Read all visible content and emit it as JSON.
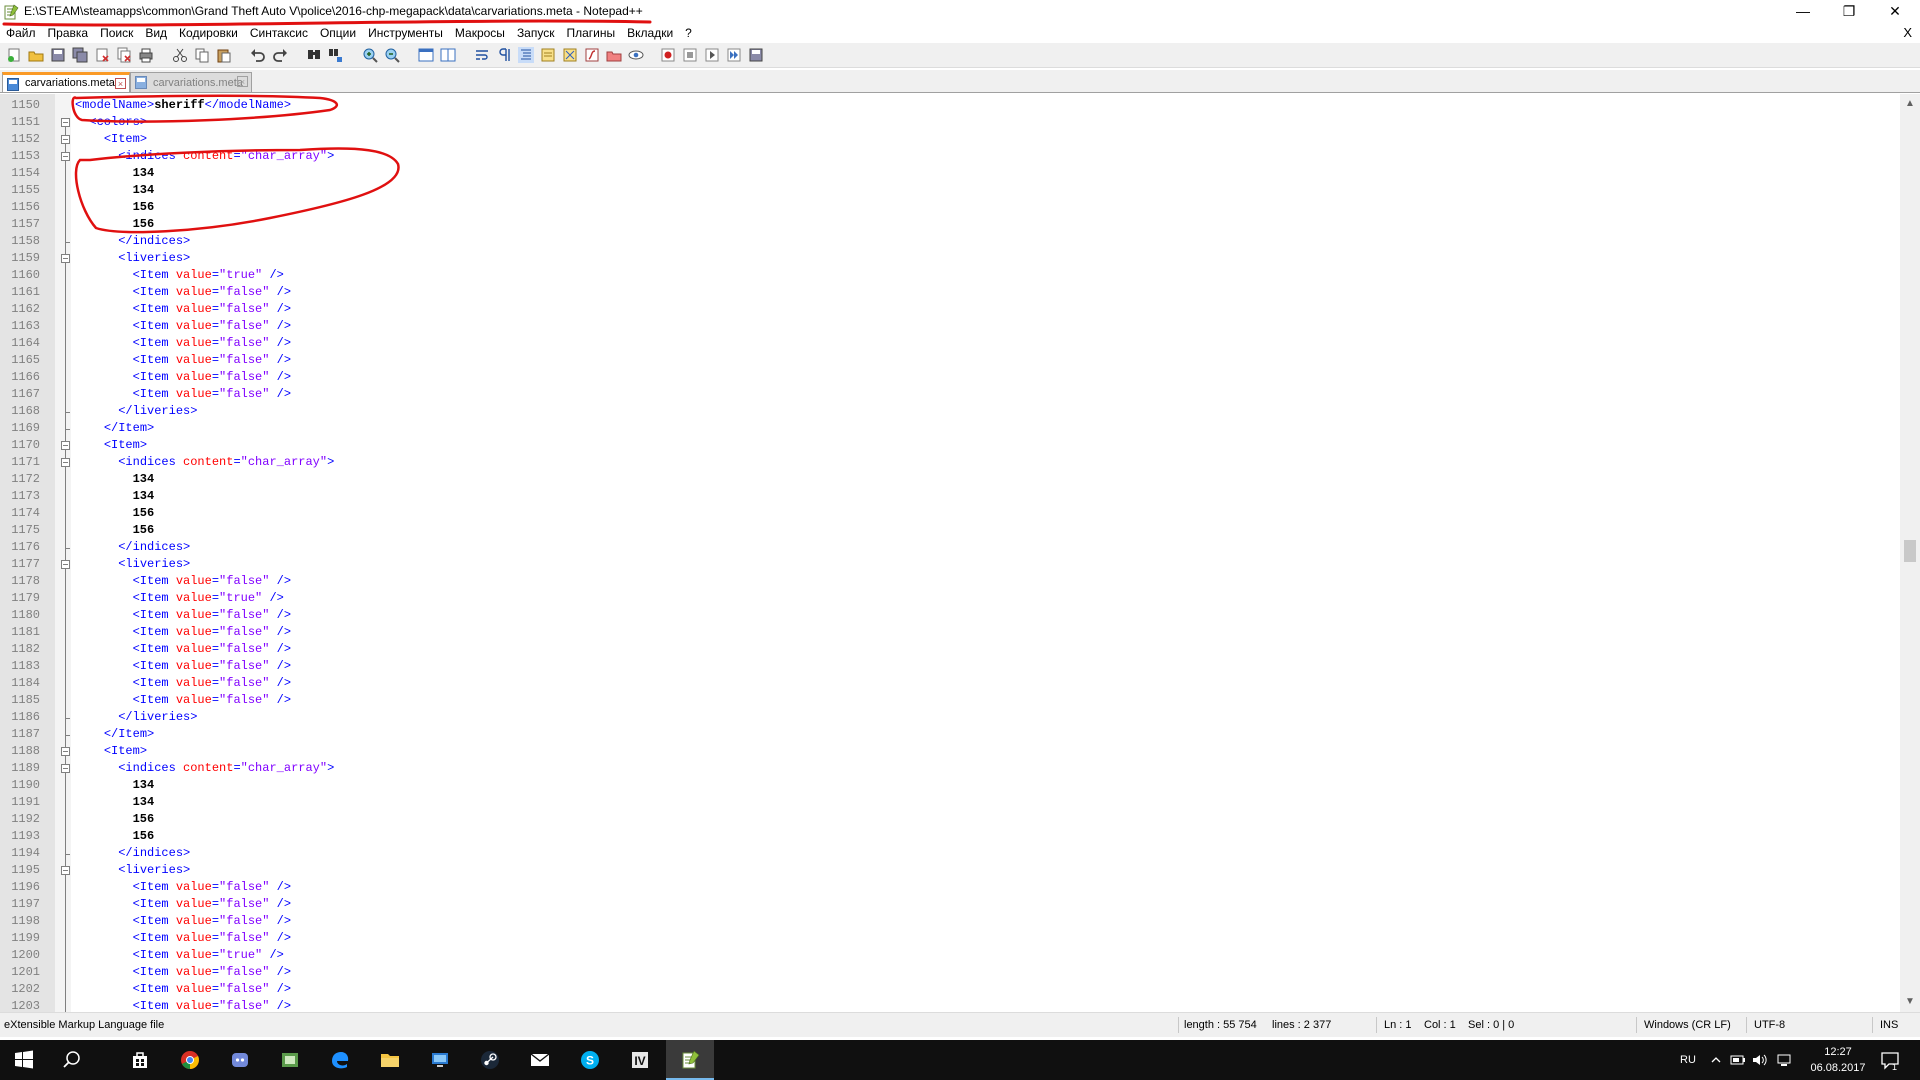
{
  "window": {
    "title": "E:\\STEAM\\steamapps\\common\\Grand Theft Auto V\\police\\2016-chp-megapack\\data\\carvariations.meta - Notepad++",
    "minimize": "—",
    "maximize": "❐",
    "close": "✕",
    "doc_close": "X"
  },
  "menu": [
    "Файл",
    "Правка",
    "Поиск",
    "Вид",
    "Кодировки",
    "Синтаксис",
    "Опции",
    "Инструменты",
    "Макросы",
    "Запуск",
    "Плагины",
    "Вкладки",
    "?"
  ],
  "tabs": [
    {
      "label": "carvariations.meta",
      "active": true
    },
    {
      "label": "carvariations.meta",
      "active": false
    }
  ],
  "code": [
    {
      "ln": "1150",
      "fold": "none",
      "tokens": [
        [
          "t",
          "<modelName>"
        ],
        [
          "x",
          "sheriff"
        ],
        [
          "t",
          "</modelName>"
        ]
      ]
    },
    {
      "ln": "1151",
      "fold": "open",
      "tokens": [
        [
          "s",
          "  "
        ],
        [
          "t",
          "<colors>"
        ]
      ]
    },
    {
      "ln": "1152",
      "fold": "open",
      "tokens": [
        [
          "s",
          "    "
        ],
        [
          "t",
          "<Item>"
        ]
      ]
    },
    {
      "ln": "1153",
      "fold": "open",
      "tokens": [
        [
          "s",
          "      "
        ],
        [
          "t",
          "<indices "
        ],
        [
          "a",
          "content"
        ],
        [
          "t",
          "="
        ],
        [
          "v",
          "\"char_array\""
        ],
        [
          "t",
          ">"
        ]
      ]
    },
    {
      "ln": "1154",
      "fold": "line",
      "tokens": [
        [
          "s",
          "        "
        ],
        [
          "x",
          "134"
        ]
      ]
    },
    {
      "ln": "1155",
      "fold": "line",
      "tokens": [
        [
          "s",
          "        "
        ],
        [
          "x",
          "134"
        ]
      ]
    },
    {
      "ln": "1156",
      "fold": "line",
      "tokens": [
        [
          "s",
          "        "
        ],
        [
          "x",
          "156"
        ]
      ]
    },
    {
      "ln": "1157",
      "fold": "line",
      "tokens": [
        [
          "s",
          "        "
        ],
        [
          "x",
          "156"
        ]
      ]
    },
    {
      "ln": "1158",
      "fold": "end",
      "tokens": [
        [
          "s",
          "      "
        ],
        [
          "t",
          "</indices>"
        ]
      ]
    },
    {
      "ln": "1159",
      "fold": "open",
      "tokens": [
        [
          "s",
          "      "
        ],
        [
          "t",
          "<liveries>"
        ]
      ]
    },
    {
      "ln": "1160",
      "fold": "line",
      "tokens": [
        [
          "s",
          "        "
        ],
        [
          "t",
          "<Item "
        ],
        [
          "a",
          "value"
        ],
        [
          "t",
          "="
        ],
        [
          "v",
          "\"true\""
        ],
        [
          "t",
          " />"
        ]
      ]
    },
    {
      "ln": "1161",
      "fold": "line",
      "tokens": [
        [
          "s",
          "        "
        ],
        [
          "t",
          "<Item "
        ],
        [
          "a",
          "value"
        ],
        [
          "t",
          "="
        ],
        [
          "v",
          "\"false\""
        ],
        [
          "t",
          " />"
        ]
      ]
    },
    {
      "ln": "1162",
      "fold": "line",
      "tokens": [
        [
          "s",
          "        "
        ],
        [
          "t",
          "<Item "
        ],
        [
          "a",
          "value"
        ],
        [
          "t",
          "="
        ],
        [
          "v",
          "\"false\""
        ],
        [
          "t",
          " />"
        ]
      ]
    },
    {
      "ln": "1163",
      "fold": "line",
      "tokens": [
        [
          "s",
          "        "
        ],
        [
          "t",
          "<Item "
        ],
        [
          "a",
          "value"
        ],
        [
          "t",
          "="
        ],
        [
          "v",
          "\"false\""
        ],
        [
          "t",
          " />"
        ]
      ]
    },
    {
      "ln": "1164",
      "fold": "line",
      "tokens": [
        [
          "s",
          "        "
        ],
        [
          "t",
          "<Item "
        ],
        [
          "a",
          "value"
        ],
        [
          "t",
          "="
        ],
        [
          "v",
          "\"false\""
        ],
        [
          "t",
          " />"
        ]
      ]
    },
    {
      "ln": "1165",
      "fold": "line",
      "tokens": [
        [
          "s",
          "        "
        ],
        [
          "t",
          "<Item "
        ],
        [
          "a",
          "value"
        ],
        [
          "t",
          "="
        ],
        [
          "v",
          "\"false\""
        ],
        [
          "t",
          " />"
        ]
      ]
    },
    {
      "ln": "1166",
      "fold": "line",
      "tokens": [
        [
          "s",
          "        "
        ],
        [
          "t",
          "<Item "
        ],
        [
          "a",
          "value"
        ],
        [
          "t",
          "="
        ],
        [
          "v",
          "\"false\""
        ],
        [
          "t",
          " />"
        ]
      ]
    },
    {
      "ln": "1167",
      "fold": "line",
      "tokens": [
        [
          "s",
          "        "
        ],
        [
          "t",
          "<Item "
        ],
        [
          "a",
          "value"
        ],
        [
          "t",
          "="
        ],
        [
          "v",
          "\"false\""
        ],
        [
          "t",
          " />"
        ]
      ]
    },
    {
      "ln": "1168",
      "fold": "end",
      "tokens": [
        [
          "s",
          "      "
        ],
        [
          "t",
          "</liveries>"
        ]
      ]
    },
    {
      "ln": "1169",
      "fold": "end",
      "tokens": [
        [
          "s",
          "    "
        ],
        [
          "t",
          "</Item>"
        ]
      ]
    },
    {
      "ln": "1170",
      "fold": "open",
      "tokens": [
        [
          "s",
          "    "
        ],
        [
          "t",
          "<Item>"
        ]
      ]
    },
    {
      "ln": "1171",
      "fold": "open",
      "tokens": [
        [
          "s",
          "      "
        ],
        [
          "t",
          "<indices "
        ],
        [
          "a",
          "content"
        ],
        [
          "t",
          "="
        ],
        [
          "v",
          "\"char_array\""
        ],
        [
          "t",
          ">"
        ]
      ]
    },
    {
      "ln": "1172",
      "fold": "line",
      "tokens": [
        [
          "s",
          "        "
        ],
        [
          "x",
          "134"
        ]
      ]
    },
    {
      "ln": "1173",
      "fold": "line",
      "tokens": [
        [
          "s",
          "        "
        ],
        [
          "x",
          "134"
        ]
      ]
    },
    {
      "ln": "1174",
      "fold": "line",
      "tokens": [
        [
          "s",
          "        "
        ],
        [
          "x",
          "156"
        ]
      ]
    },
    {
      "ln": "1175",
      "fold": "line",
      "tokens": [
        [
          "s",
          "        "
        ],
        [
          "x",
          "156"
        ]
      ]
    },
    {
      "ln": "1176",
      "fold": "end",
      "tokens": [
        [
          "s",
          "      "
        ],
        [
          "t",
          "</indices>"
        ]
      ]
    },
    {
      "ln": "1177",
      "fold": "open",
      "tokens": [
        [
          "s",
          "      "
        ],
        [
          "t",
          "<liveries>"
        ]
      ]
    },
    {
      "ln": "1178",
      "fold": "line",
      "tokens": [
        [
          "s",
          "        "
        ],
        [
          "t",
          "<Item "
        ],
        [
          "a",
          "value"
        ],
        [
          "t",
          "="
        ],
        [
          "v",
          "\"false\""
        ],
        [
          "t",
          " />"
        ]
      ]
    },
    {
      "ln": "1179",
      "fold": "line",
      "tokens": [
        [
          "s",
          "        "
        ],
        [
          "t",
          "<Item "
        ],
        [
          "a",
          "value"
        ],
        [
          "t",
          "="
        ],
        [
          "v",
          "\"true\""
        ],
        [
          "t",
          " />"
        ]
      ]
    },
    {
      "ln": "1180",
      "fold": "line",
      "tokens": [
        [
          "s",
          "        "
        ],
        [
          "t",
          "<Item "
        ],
        [
          "a",
          "value"
        ],
        [
          "t",
          "="
        ],
        [
          "v",
          "\"false\""
        ],
        [
          "t",
          " />"
        ]
      ]
    },
    {
      "ln": "1181",
      "fold": "line",
      "tokens": [
        [
          "s",
          "        "
        ],
        [
          "t",
          "<Item "
        ],
        [
          "a",
          "value"
        ],
        [
          "t",
          "="
        ],
        [
          "v",
          "\"false\""
        ],
        [
          "t",
          " />"
        ]
      ]
    },
    {
      "ln": "1182",
      "fold": "line",
      "tokens": [
        [
          "s",
          "        "
        ],
        [
          "t",
          "<Item "
        ],
        [
          "a",
          "value"
        ],
        [
          "t",
          "="
        ],
        [
          "v",
          "\"false\""
        ],
        [
          "t",
          " />"
        ]
      ]
    },
    {
      "ln": "1183",
      "fold": "line",
      "tokens": [
        [
          "s",
          "        "
        ],
        [
          "t",
          "<Item "
        ],
        [
          "a",
          "value"
        ],
        [
          "t",
          "="
        ],
        [
          "v",
          "\"false\""
        ],
        [
          "t",
          " />"
        ]
      ]
    },
    {
      "ln": "1184",
      "fold": "line",
      "tokens": [
        [
          "s",
          "        "
        ],
        [
          "t",
          "<Item "
        ],
        [
          "a",
          "value"
        ],
        [
          "t",
          "="
        ],
        [
          "v",
          "\"false\""
        ],
        [
          "t",
          " />"
        ]
      ]
    },
    {
      "ln": "1185",
      "fold": "line",
      "tokens": [
        [
          "s",
          "        "
        ],
        [
          "t",
          "<Item "
        ],
        [
          "a",
          "value"
        ],
        [
          "t",
          "="
        ],
        [
          "v",
          "\"false\""
        ],
        [
          "t",
          " />"
        ]
      ]
    },
    {
      "ln": "1186",
      "fold": "end",
      "tokens": [
        [
          "s",
          "      "
        ],
        [
          "t",
          "</liveries>"
        ]
      ]
    },
    {
      "ln": "1187",
      "fold": "end",
      "tokens": [
        [
          "s",
          "    "
        ],
        [
          "t",
          "</Item>"
        ]
      ]
    },
    {
      "ln": "1188",
      "fold": "open",
      "tokens": [
        [
          "s",
          "    "
        ],
        [
          "t",
          "<Item>"
        ]
      ]
    },
    {
      "ln": "1189",
      "fold": "open",
      "tokens": [
        [
          "s",
          "      "
        ],
        [
          "t",
          "<indices "
        ],
        [
          "a",
          "content"
        ],
        [
          "t",
          "="
        ],
        [
          "v",
          "\"char_array\""
        ],
        [
          "t",
          ">"
        ]
      ]
    },
    {
      "ln": "1190",
      "fold": "line",
      "tokens": [
        [
          "s",
          "        "
        ],
        [
          "x",
          "134"
        ]
      ]
    },
    {
      "ln": "1191",
      "fold": "line",
      "tokens": [
        [
          "s",
          "        "
        ],
        [
          "x",
          "134"
        ]
      ]
    },
    {
      "ln": "1192",
      "fold": "line",
      "tokens": [
        [
          "s",
          "        "
        ],
        [
          "x",
          "156"
        ]
      ]
    },
    {
      "ln": "1193",
      "fold": "line",
      "tokens": [
        [
          "s",
          "        "
        ],
        [
          "x",
          "156"
        ]
      ]
    },
    {
      "ln": "1194",
      "fold": "end",
      "tokens": [
        [
          "s",
          "      "
        ],
        [
          "t",
          "</indices>"
        ]
      ]
    },
    {
      "ln": "1195",
      "fold": "open",
      "tokens": [
        [
          "s",
          "      "
        ],
        [
          "t",
          "<liveries>"
        ]
      ]
    },
    {
      "ln": "1196",
      "fold": "line",
      "tokens": [
        [
          "s",
          "        "
        ],
        [
          "t",
          "<Item "
        ],
        [
          "a",
          "value"
        ],
        [
          "t",
          "="
        ],
        [
          "v",
          "\"false\""
        ],
        [
          "t",
          " />"
        ]
      ]
    },
    {
      "ln": "1197",
      "fold": "line",
      "tokens": [
        [
          "s",
          "        "
        ],
        [
          "t",
          "<Item "
        ],
        [
          "a",
          "value"
        ],
        [
          "t",
          "="
        ],
        [
          "v",
          "\"false\""
        ],
        [
          "t",
          " />"
        ]
      ]
    },
    {
      "ln": "1198",
      "fold": "line",
      "tokens": [
        [
          "s",
          "        "
        ],
        [
          "t",
          "<Item "
        ],
        [
          "a",
          "value"
        ],
        [
          "t",
          "="
        ],
        [
          "v",
          "\"false\""
        ],
        [
          "t",
          " />"
        ]
      ]
    },
    {
      "ln": "1199",
      "fold": "line",
      "tokens": [
        [
          "s",
          "        "
        ],
        [
          "t",
          "<Item "
        ],
        [
          "a",
          "value"
        ],
        [
          "t",
          "="
        ],
        [
          "v",
          "\"false\""
        ],
        [
          "t",
          " />"
        ]
      ]
    },
    {
      "ln": "1200",
      "fold": "line",
      "tokens": [
        [
          "s",
          "        "
        ],
        [
          "t",
          "<Item "
        ],
        [
          "a",
          "value"
        ],
        [
          "t",
          "="
        ],
        [
          "v",
          "\"true\""
        ],
        [
          "t",
          " />"
        ]
      ]
    },
    {
      "ln": "1201",
      "fold": "line",
      "tokens": [
        [
          "s",
          "        "
        ],
        [
          "t",
          "<Item "
        ],
        [
          "a",
          "value"
        ],
        [
          "t",
          "="
        ],
        [
          "v",
          "\"false\""
        ],
        [
          "t",
          " />"
        ]
      ]
    },
    {
      "ln": "1202",
      "fold": "line",
      "tokens": [
        [
          "s",
          "        "
        ],
        [
          "t",
          "<Item "
        ],
        [
          "a",
          "value"
        ],
        [
          "t",
          "="
        ],
        [
          "v",
          "\"false\""
        ],
        [
          "t",
          " />"
        ]
      ]
    },
    {
      "ln": "1203",
      "fold": "line",
      "tokens": [
        [
          "s",
          "        "
        ],
        [
          "t",
          "<Item "
        ],
        [
          "a",
          "value"
        ],
        [
          "t",
          "="
        ],
        [
          "v",
          "\"false\""
        ],
        [
          "t",
          " />"
        ]
      ]
    }
  ],
  "statusbar": {
    "filetype": "eXtensible Markup Language file",
    "length": "length : 55 754",
    "lines": "lines : 2 377",
    "ln": "Ln : 1",
    "col": "Col : 1",
    "sel": "Sel : 0 | 0",
    "eol": "Windows (CR LF)",
    "encoding": "UTF-8",
    "mode": "INS"
  },
  "taskbar": {
    "language": "RU",
    "time": "12:27",
    "date": "06.08.2017",
    "notifications": "1"
  },
  "colors": {
    "tag": "#0000ff",
    "attr": "#ff0000",
    "value": "#8000ff",
    "annotation": "#e01010",
    "tab_accent": "#fa9a26"
  }
}
